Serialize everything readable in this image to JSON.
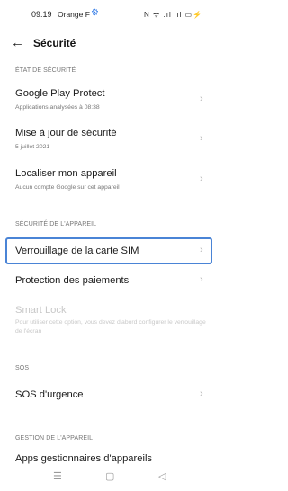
{
  "status": {
    "time": "09:19",
    "carrier": "Orange F",
    "gear": "⚙",
    "right_icons": "N ᯤ .ıl ᵎıl ▭⚡"
  },
  "header": {
    "back": "←",
    "title": "Sécurité"
  },
  "sections": {
    "etat": "ÉTAT DE SÉCURITÉ",
    "appareil": "SÉCURITÉ DE L'APPAREIL",
    "sos": "SOS",
    "gestion": "GESTION DE L'APPAREIL"
  },
  "items": {
    "play_protect": {
      "title": "Google Play Protect",
      "sub": "Applications analysées à 08:38"
    },
    "maj": {
      "title": "Mise à jour de sécurité",
      "sub": "5 juillet 2021"
    },
    "localiser": {
      "title": "Localiser mon appareil",
      "sub": "Aucun compte Google sur cet appareil"
    },
    "sim": {
      "title": "Verrouillage de la carte SIM"
    },
    "paiements": {
      "title": "Protection des paiements"
    },
    "smartlock": {
      "title": "Smart Lock",
      "sub": "Pour utiliser cette option, vous devez d'abord configurer le verrouillage de l'écran"
    },
    "sos_urgence": {
      "title": "SOS d'urgence"
    },
    "apps_gestion": {
      "title": "Apps gestionnaires d'appareils"
    }
  },
  "chevron": "›",
  "nav": {
    "menu": "☰",
    "home": "▢",
    "back": "◁"
  }
}
